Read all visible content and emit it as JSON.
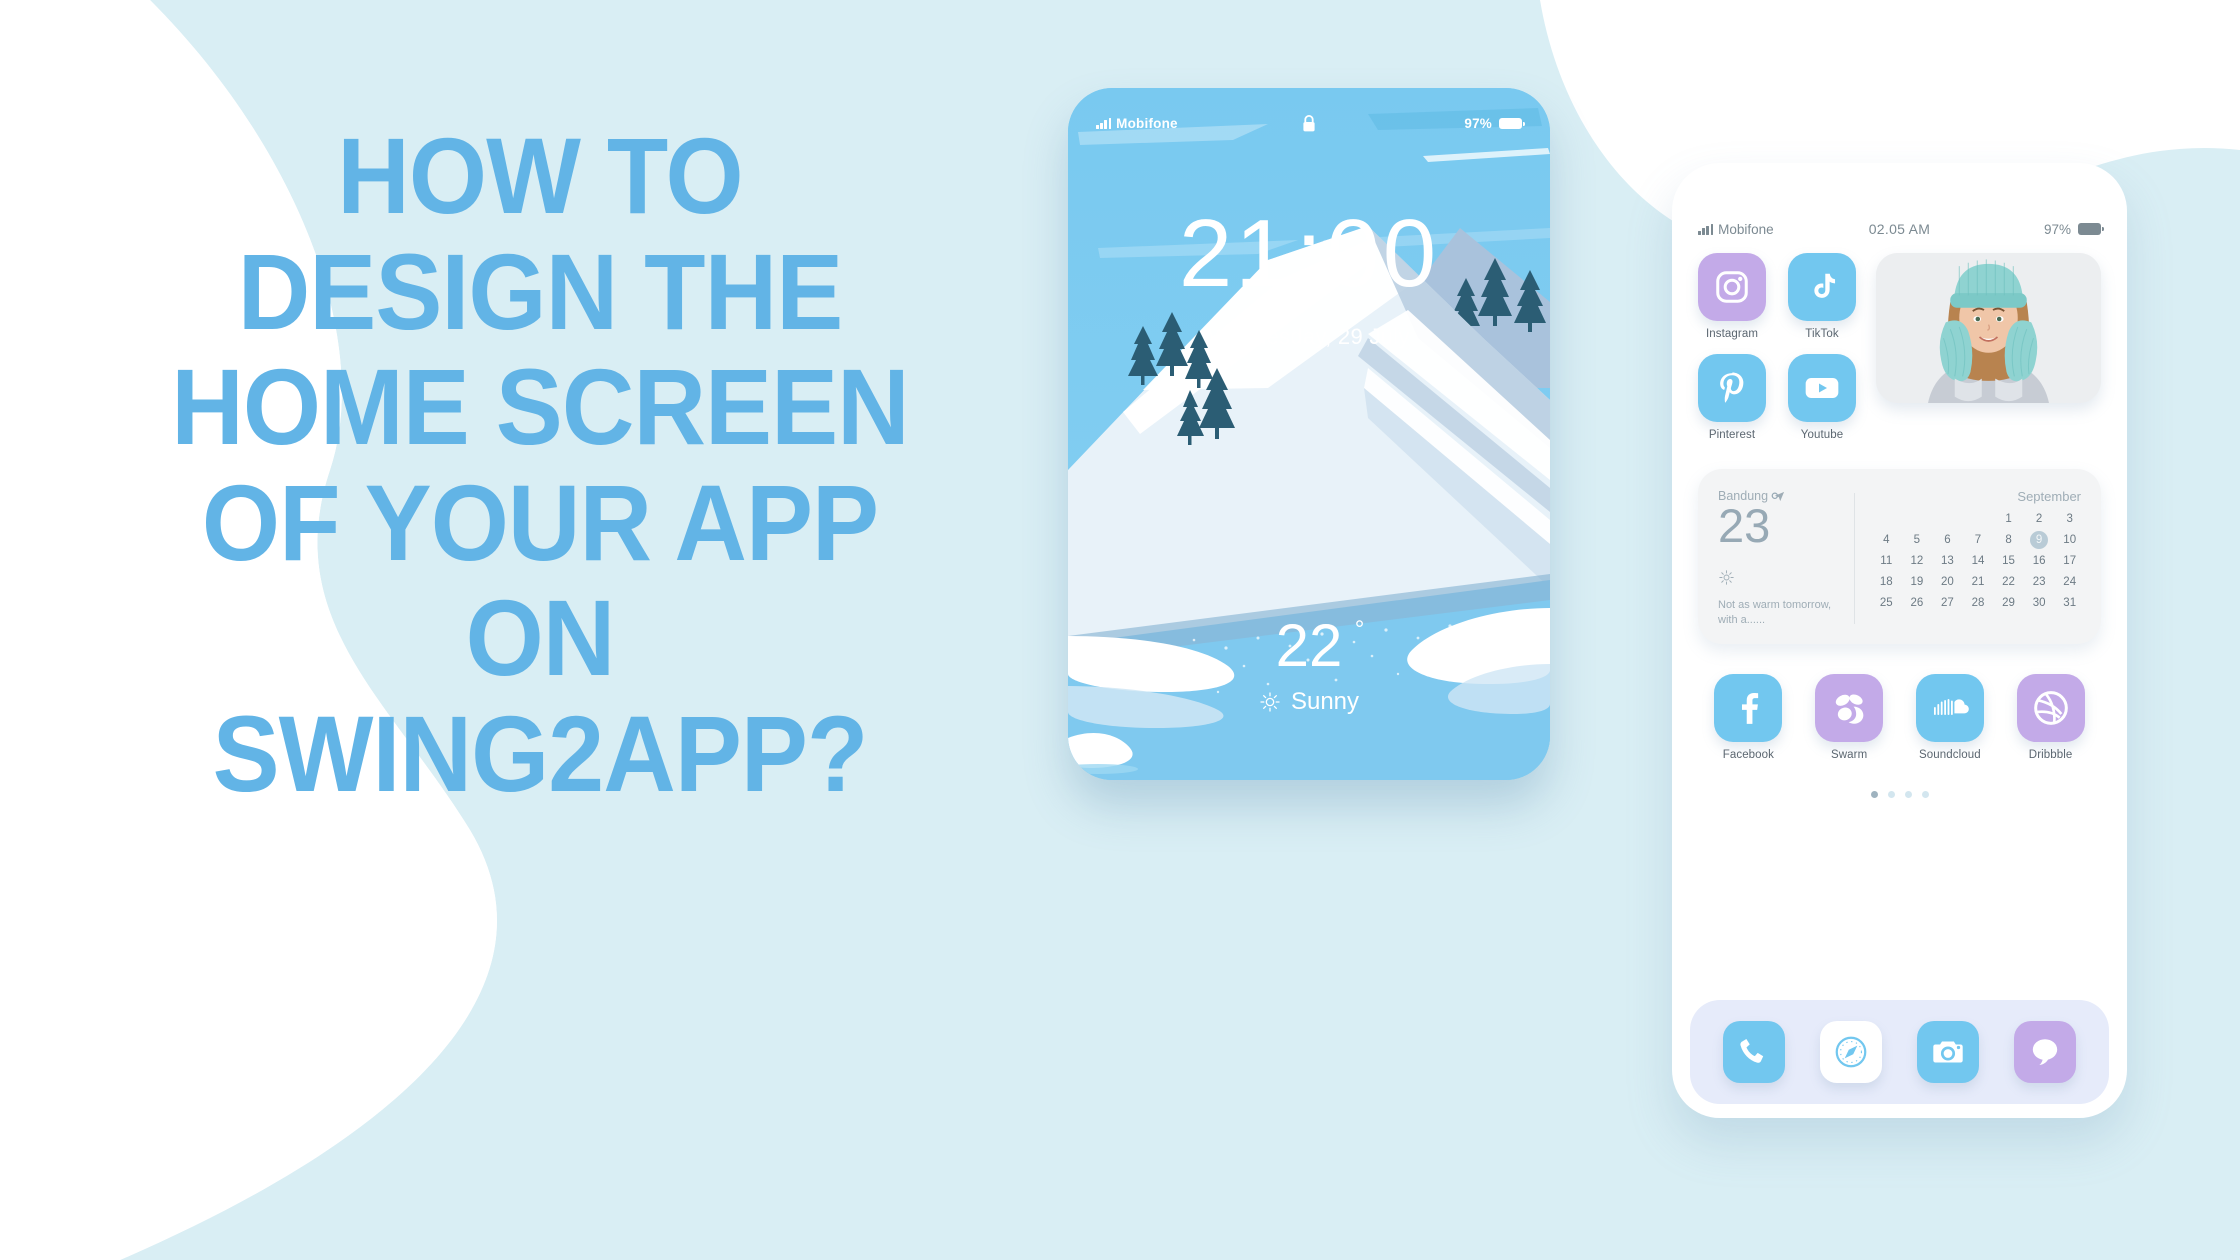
{
  "poster": {
    "headline_lines": [
      "HOW TO",
      "DESIGN THE",
      "HOME SCREEN",
      "OF YOUR APP",
      "ON",
      "SWING2APP?"
    ],
    "colors": {
      "headline": "#62b4e6",
      "background_tint": "#d9eef4",
      "background_white": "#ffffff"
    }
  },
  "lock_screen": {
    "status_bar": {
      "carrier": "Mobifone",
      "signal_icon": "signal-bars-icon",
      "lock_icon": "lock-icon",
      "battery_percent": "97%",
      "battery_icon": "battery-icon"
    },
    "clock": {
      "hours": "21",
      "separator": ":",
      "minutes": "00"
    },
    "date": "Wednesday, 29 July",
    "weather": {
      "temperature": "22",
      "degree": "°",
      "condition": "Sunny",
      "condition_icon": "sun-icon"
    },
    "wallpaper": {
      "scene": "winter-mountain-landscape",
      "sky": "#7ecbf0",
      "snow": "#eef6fb",
      "trees": "#2b5d74",
      "river": "#6ec4ef"
    }
  },
  "home_screen": {
    "status_bar": {
      "carrier": "Mobifone",
      "signal_icon": "signal-bars-icon",
      "time": "02.05 AM",
      "battery_percent": "97%",
      "battery_icon": "battery-icon"
    },
    "apps_top": [
      {
        "label": "Instagram",
        "icon": "instagram-icon",
        "bg": "#c3aae8"
      },
      {
        "label": "TikTok",
        "icon": "tiktok-icon",
        "bg": "#72c7ef"
      },
      {
        "label": "Pinterest",
        "icon": "pinterest-icon",
        "bg": "#72c7ef"
      },
      {
        "label": "Youtube",
        "icon": "youtube-icon",
        "bg": "#72c7ef"
      }
    ],
    "photo_widget": {
      "alt": "woman-in-teal-knit-hat-and-mittens",
      "icon": "photo-widget"
    },
    "weather_calendar_widget": {
      "city": "Bandung",
      "location_icon": "location-arrow-icon",
      "temperature": "23",
      "degree": "°",
      "condition_icon": "sun-icon",
      "note": "Not as warm tomorrow, with a......",
      "calendar": {
        "month": "September",
        "leading_blanks": 4,
        "days": [
          1,
          2,
          3,
          4,
          5,
          6,
          7,
          8,
          9,
          10,
          11,
          12,
          13,
          14,
          15,
          16,
          17,
          18,
          19,
          20,
          21,
          22,
          23,
          24,
          25,
          26,
          27,
          28,
          29,
          30,
          31
        ],
        "today": 9
      }
    },
    "apps_bottom": [
      {
        "label": "Facebook",
        "icon": "facebook-icon",
        "bg": "#72c7ef"
      },
      {
        "label": "Swarm",
        "icon": "swarm-icon",
        "bg": "#c3aae8"
      },
      {
        "label": "Soundcloud",
        "icon": "soundcloud-icon",
        "bg": "#72c7ef"
      },
      {
        "label": "Dribbble",
        "icon": "dribbble-icon",
        "bg": "#c3aae8"
      }
    ],
    "page_dots": {
      "count": 4,
      "active_index": 0
    },
    "dock": [
      {
        "name": "Phone",
        "icon": "phone-icon",
        "bg": "#72c7ef"
      },
      {
        "name": "Safari",
        "icon": "compass-icon",
        "bg": "#ffffff"
      },
      {
        "name": "Camera",
        "icon": "camera-icon",
        "bg": "#72c7ef"
      },
      {
        "name": "Messages",
        "icon": "message-icon",
        "bg": "#c3aae8"
      }
    ]
  }
}
